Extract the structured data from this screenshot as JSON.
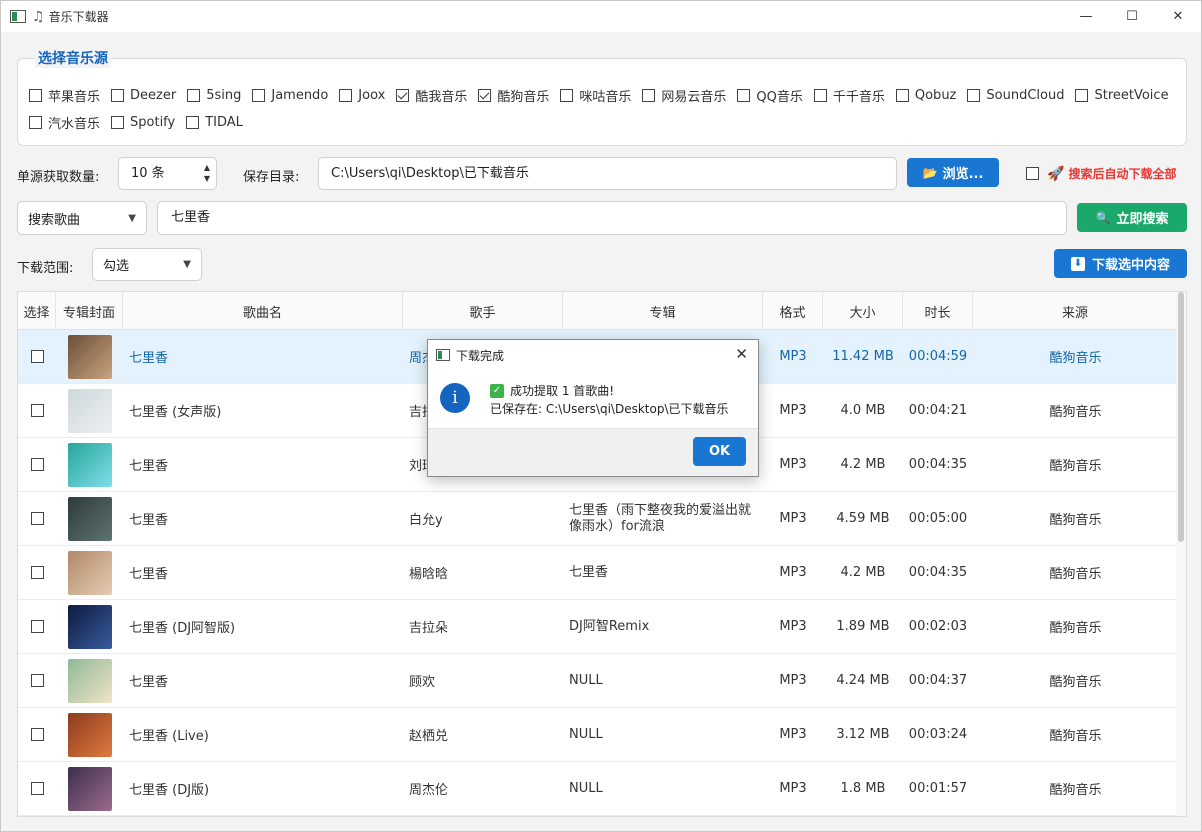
{
  "window": {
    "title": "音乐下载器",
    "controls": {
      "minimize": "—",
      "maximize": "☐",
      "close": "✕"
    }
  },
  "sources": {
    "title": "选择音乐源",
    "row1": [
      {
        "label": "苹果音乐",
        "checked": false
      },
      {
        "label": "Deezer",
        "checked": false
      },
      {
        "label": "5sing",
        "checked": false
      },
      {
        "label": "Jamendo",
        "checked": false
      },
      {
        "label": "Joox",
        "checked": false
      },
      {
        "label": "酷我音乐",
        "checked": true
      },
      {
        "label": "酷狗音乐",
        "checked": true
      },
      {
        "label": "咪咕音乐",
        "checked": false
      },
      {
        "label": "网易云音乐",
        "checked": false
      },
      {
        "label": "QQ音乐",
        "checked": false
      },
      {
        "label": "千千音乐",
        "checked": false
      },
      {
        "label": "Qobuz",
        "checked": false
      },
      {
        "label": "SoundCloud",
        "checked": false
      },
      {
        "label": "StreetVoice",
        "checked": false
      }
    ],
    "row2": [
      {
        "label": "汽水音乐",
        "checked": false
      },
      {
        "label": "Spotify",
        "checked": false
      },
      {
        "label": "TIDAL",
        "checked": false
      }
    ]
  },
  "settings": {
    "count_label": "单源获取数量:",
    "count_value": "10 条",
    "dir_label": "保存目录:",
    "dir_value": "C:\\Users\\qi\\Desktop\\已下载音乐",
    "browse_label": "浏览...",
    "auto_download_label": "搜索后自动下载全部",
    "auto_download_checked": false
  },
  "search": {
    "type_value": "搜索歌曲",
    "query": "七里香",
    "button_label": "立即搜索"
  },
  "download": {
    "range_label": "下载范围:",
    "range_value": "勾选",
    "button_label": "下载选中内容"
  },
  "table": {
    "headers": [
      "选择",
      "专辑封面",
      "歌曲名",
      "歌手",
      "专辑",
      "格式",
      "大小",
      "时长",
      "来源"
    ],
    "rows": [
      {
        "title": "七里香",
        "artist": "周杰伦",
        "album": "七里香",
        "format": "MP3",
        "size": "11.42 MB",
        "duration": "00:04:59",
        "source": "酷狗音乐",
        "selected": true,
        "cover": [
          "#6b4f3a",
          "#c9a27e"
        ]
      },
      {
        "title": "七里香 (女声版)",
        "artist": "吉拉朵",
        "album": "",
        "format": "MP3",
        "size": "4.0 MB",
        "duration": "00:04:21",
        "source": "酷狗音乐",
        "selected": false,
        "cover": [
          "#cfd8dc",
          "#eceff1"
        ]
      },
      {
        "title": "七里香",
        "artist": "刘瑞琦",
        "album": "",
        "format": "MP3",
        "size": "4.2 MB",
        "duration": "00:04:35",
        "source": "酷狗音乐",
        "selected": false,
        "cover": [
          "#26a69a",
          "#80deea"
        ]
      },
      {
        "title": "七里香",
        "artist": "白允y",
        "album": "七里香（雨下整夜我的爱溢出就像雨水）for流浪",
        "format": "MP3",
        "size": "4.59 MB",
        "duration": "00:05:00",
        "source": "酷狗音乐",
        "selected": false,
        "cover": [
          "#2e3b3a",
          "#5d7370"
        ]
      },
      {
        "title": "七里香",
        "artist": "楊晗晗",
        "album": "七里香",
        "format": "MP3",
        "size": "4.2 MB",
        "duration": "00:04:35",
        "source": "酷狗音乐",
        "selected": false,
        "cover": [
          "#b08968",
          "#e6ccb2"
        ]
      },
      {
        "title": "七里香 (DJ阿智版)",
        "artist": "吉拉朵",
        "album": "DJ阿智Remix",
        "format": "MP3",
        "size": "1.89 MB",
        "duration": "00:02:03",
        "source": "酷狗音乐",
        "selected": false,
        "cover": [
          "#0d1b3e",
          "#3a5ba0"
        ]
      },
      {
        "title": "七里香",
        "artist": "顾欢",
        "album": "NULL",
        "format": "MP3",
        "size": "4.24 MB",
        "duration": "00:04:37",
        "source": "酷狗音乐",
        "selected": false,
        "cover": [
          "#8fb996",
          "#f1e3c6"
        ]
      },
      {
        "title": "七里香 (Live)",
        "artist": "赵栖兑",
        "album": "NULL",
        "format": "MP3",
        "size": "3.12 MB",
        "duration": "00:03:24",
        "source": "酷狗音乐",
        "selected": false,
        "cover": [
          "#8d3b1f",
          "#e07a3f"
        ]
      },
      {
        "title": "七里香 (DJ版)",
        "artist": "周杰伦",
        "album": "NULL",
        "format": "MP3",
        "size": "1.8 MB",
        "duration": "00:01:57",
        "source": "酷狗音乐",
        "selected": false,
        "cover": [
          "#3b2f4a",
          "#9c6b8e"
        ]
      }
    ]
  },
  "dialog": {
    "title": "下载完成",
    "line1": "成功提取 1 首歌曲!",
    "line2": "已保存在: C:\\Users\\qi\\Desktop\\已下载音乐",
    "ok_label": "OK"
  },
  "colors": {
    "accent_blue": "#1976d2",
    "accent_green": "#1aa86b",
    "warning_red": "#e53935",
    "selected_row": "#e3f2fc"
  }
}
